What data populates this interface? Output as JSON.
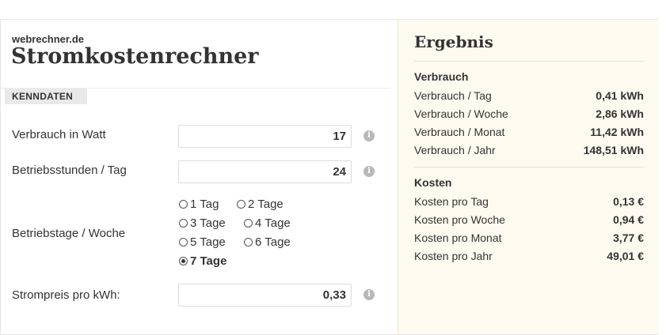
{
  "header": {
    "brand": "webrechner.de",
    "title": "Stromkostenrechner"
  },
  "section": {
    "label": "KENNDATEN"
  },
  "form": {
    "watt": {
      "label": "Verbrauch in Watt",
      "value": "17"
    },
    "hours": {
      "label": "Betriebsstunden / Tag",
      "value": "24"
    },
    "days": {
      "label": "Betriebstage / Woche",
      "options": [
        "1 Tag",
        "2 Tage",
        "3 Tage",
        "4 Tage",
        "5 Tage",
        "6 Tage",
        "7 Tage"
      ],
      "selected": "7 Tage"
    },
    "price": {
      "label": "Strompreis pro kWh:",
      "value": "0,33"
    },
    "info_glyph": "i"
  },
  "result": {
    "title": "Ergebnis",
    "verbrauch": {
      "heading": "Verbrauch",
      "rows": [
        {
          "label": "Verbrauch / Tag",
          "value": "0,41 kWh"
        },
        {
          "label": "Verbrauch / Woche",
          "value": "2,86 kWh"
        },
        {
          "label": "Verbrauch / Monat",
          "value": "11,42 kWh"
        },
        {
          "label": "Verbrauch / Jahr",
          "value": "148,51 kWh"
        }
      ]
    },
    "kosten": {
      "heading": "Kosten",
      "rows": [
        {
          "label": "Kosten pro Tag",
          "value": "0,13 €"
        },
        {
          "label": "Kosten pro Woche",
          "value": "0,94 €"
        },
        {
          "label": "Kosten pro Monat",
          "value": "3,77 €"
        },
        {
          "label": "Kosten pro Jahr",
          "value": "49,01 €"
        }
      ]
    }
  },
  "colors": {
    "result_background": "#fdfaf0",
    "section_tab_background": "#e9e9e9",
    "info_icon": "#b8b8b8"
  }
}
